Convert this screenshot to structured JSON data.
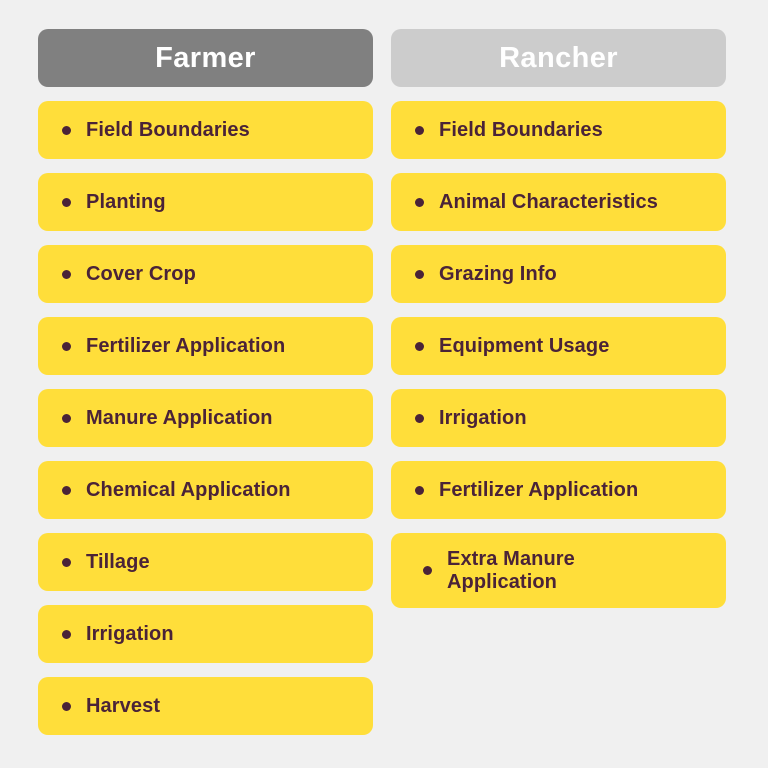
{
  "page": {
    "background_color": "#f0f0f0",
    "card_color": "#ffde3a",
    "card_text_color": "#4a2338",
    "bullet_icon": "bullet-dot"
  },
  "columns": [
    {
      "id": "farmer",
      "header": {
        "title": "Farmer",
        "background_color": "#808080",
        "text_color": "#ffffff"
      },
      "items": [
        {
          "label": "Field Boundaries"
        },
        {
          "label": "Planting"
        },
        {
          "label": "Cover Crop"
        },
        {
          "label": "Fertilizer Application"
        },
        {
          "label": "Manure Application"
        },
        {
          "label": "Chemical Application"
        },
        {
          "label": "Tillage"
        },
        {
          "label": "Irrigation"
        },
        {
          "label": "Harvest"
        }
      ]
    },
    {
      "id": "rancher",
      "header": {
        "title": "Rancher",
        "background_color": "#cccccc",
        "text_color": "#ffffff"
      },
      "items": [
        {
          "label": "Field Boundaries"
        },
        {
          "label": "Animal Characteristics"
        },
        {
          "label": "Grazing Info"
        },
        {
          "label": "Equipment Usage"
        },
        {
          "label": "Irrigation"
        },
        {
          "label": "Fertilizer Application"
        },
        {
          "label": "Extra Manure Application"
        }
      ]
    }
  ]
}
